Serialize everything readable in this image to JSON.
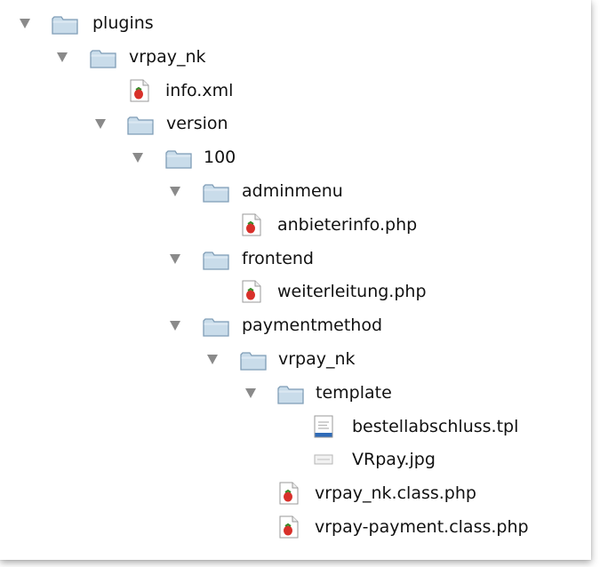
{
  "tree": {
    "items": [
      {
        "label": "plugins",
        "type": "folder",
        "expanded": true,
        "icon": "folder-icon"
      },
      {
        "label": "vrpay_nk",
        "type": "folder",
        "expanded": true,
        "icon": "folder-icon"
      },
      {
        "label": "info.xml",
        "type": "file",
        "icon": "php-file-icon"
      },
      {
        "label": "version",
        "type": "folder",
        "expanded": true,
        "icon": "folder-icon"
      },
      {
        "label": "100",
        "type": "folder",
        "expanded": true,
        "icon": "folder-icon"
      },
      {
        "label": "adminmenu",
        "type": "folder",
        "expanded": true,
        "icon": "folder-icon"
      },
      {
        "label": "anbieterinfo.php",
        "type": "file",
        "icon": "php-file-icon"
      },
      {
        "label": "frontend",
        "type": "folder",
        "expanded": true,
        "icon": "folder-icon"
      },
      {
        "label": "weiterleitung.php",
        "type": "file",
        "icon": "php-file-icon"
      },
      {
        "label": "paymentmethod",
        "type": "folder",
        "expanded": true,
        "icon": "folder-icon"
      },
      {
        "label": "vrpay_nk",
        "type": "folder",
        "expanded": true,
        "icon": "folder-icon"
      },
      {
        "label": "template",
        "type": "folder",
        "expanded": true,
        "icon": "folder-icon"
      },
      {
        "label": "bestellabschluss.tpl",
        "type": "file",
        "icon": "text-file-icon"
      },
      {
        "label": "VRpay.jpg",
        "type": "file",
        "icon": "image-file-icon"
      },
      {
        "label": "vrpay_nk.class.php",
        "type": "file",
        "icon": "php-file-icon"
      },
      {
        "label": "vrpay-payment.class.php",
        "type": "file",
        "icon": "php-file-icon"
      }
    ]
  },
  "colors": {
    "folder_fill": "#c9dcea",
    "folder_stroke": "#7f9db6",
    "triangle": "#8a8a8a",
    "text": "#111111",
    "strawberry": "#d8302a"
  }
}
